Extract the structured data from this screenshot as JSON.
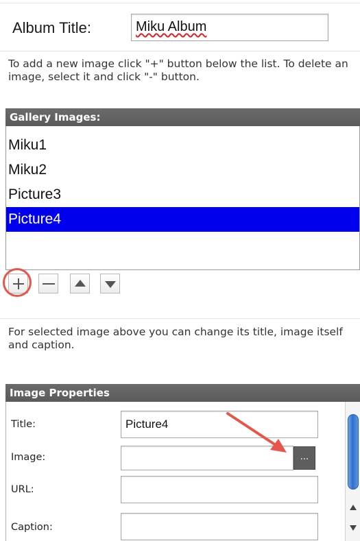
{
  "album": {
    "label": "Album Title:",
    "value": "Miku Album"
  },
  "help_add": "To add a new image click \"+\" button below the list. To delete an image, select it and click \"-\" button.",
  "gallery": {
    "header": "Gallery Images:",
    "items": [
      "Miku1",
      "Miku2",
      "Picture3",
      "Picture4"
    ],
    "selected": "Picture4"
  },
  "toolbar": {
    "add_icon": "plus-icon",
    "remove_icon": "minus-icon",
    "up_icon": "arrow-up-icon",
    "down_icon": "arrow-down-icon"
  },
  "help_selected": "For selected image above you can change its title, image itself and caption.",
  "properties": {
    "header": "Image Properties",
    "title_label": "Title:",
    "title_value": "Picture4",
    "image_label": "Image:",
    "image_value": "",
    "browse_label": "...",
    "url_label": "URL:",
    "url_value": "",
    "caption_label": "Caption:",
    "caption_value": ""
  },
  "colors": {
    "selection": "#0000ee",
    "header_bg": "#5e5e5e",
    "annotation": "#e8554a"
  }
}
